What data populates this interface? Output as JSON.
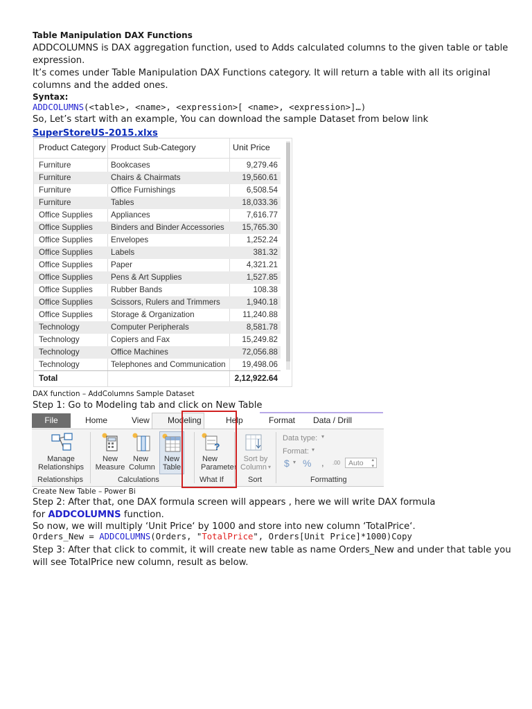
{
  "heading": "Table Manipulation DAX Functions",
  "intro_1": "ADDCOLUMNS is DAX aggregation function, used to Adds calculated columns to the given table or table",
  "intro_2": "expression.",
  "intro_3": "It’s comes under Table Manipulation DAX Functions category. It will return a table with all its original",
  "intro_4": "columns and the added ones.",
  "syntax_label": "Syntax:",
  "syntax_func": "ADDCOLUMNS",
  "syntax_rest": "(<table>, <name>, <expression>[ <name>, <expression>]…)",
  "example_line": "So, Let’s start with an example, You can download the sample Dataset from below link",
  "dataset_link": "SuperStoreUS-2015.xlxs",
  "table": {
    "headers": [
      "Product Category",
      "Product Sub-Category",
      "Unit Price"
    ],
    "rows": [
      [
        "Furniture",
        "Bookcases",
        "9,279.46"
      ],
      [
        "Furniture",
        "Chairs & Chairmats",
        "19,560.61"
      ],
      [
        "Furniture",
        "Office Furnishings",
        "6,508.54"
      ],
      [
        "Furniture",
        "Tables",
        "18,033.36"
      ],
      [
        "Office Supplies",
        "Appliances",
        "7,616.77"
      ],
      [
        "Office Supplies",
        "Binders and Binder Accessories",
        "15,765.30"
      ],
      [
        "Office Supplies",
        "Envelopes",
        "1,252.24"
      ],
      [
        "Office Supplies",
        "Labels",
        "381.32"
      ],
      [
        "Office Supplies",
        "Paper",
        "4,321.21"
      ],
      [
        "Office Supplies",
        "Pens & Art Supplies",
        "1,527.85"
      ],
      [
        "Office Supplies",
        "Rubber Bands",
        "108.38"
      ],
      [
        "Office Supplies",
        "Scissors, Rulers and Trimmers",
        "1,940.18"
      ],
      [
        "Office Supplies",
        "Storage & Organization",
        "11,240.88"
      ],
      [
        "Technology",
        "Computer Peripherals",
        "8,581.78"
      ],
      [
        "Technology",
        "Copiers and Fax",
        "15,249.82"
      ],
      [
        "Technology",
        "Office Machines",
        "72,056.88"
      ],
      [
        "Technology",
        "Telephones and Communication",
        "19,498.06"
      ]
    ],
    "total_label": "Total",
    "total_value": "2,12,922.64"
  },
  "caption_1": "DAX function – AddColumns Sample Dataset",
  "step1": "Step 1: Go to Modeling tab and click on New Table",
  "ribbon": {
    "tabs": {
      "file": "File",
      "home": "Home",
      "view": "View",
      "modeling": "Modeling",
      "help": "Help",
      "format": "Format",
      "data_drill": "Data / Drill"
    },
    "manage_1": "Manage",
    "manage_2": "Relationships",
    "new_measure_1": "New",
    "new_measure_2": "Measure",
    "new_column_1": "New",
    "new_column_2": "Column",
    "new_table_1": "New",
    "new_table_2": "Table",
    "new_param_1": "New",
    "new_param_2": "Parameter",
    "sort_1": "Sort by",
    "sort_2": "Column",
    "data_type": "Data type:",
    "format": "Format:",
    "auto": "Auto",
    "groups": {
      "relationships": "Relationships",
      "calculations": "Calculations",
      "what_if": "What If",
      "sort": "Sort",
      "formatting": "Formatting"
    },
    "colors": {
      "highlight": "#d02020",
      "file_tab": "#6d6d6d"
    }
  },
  "caption_2": "Create New Table – Power Bi",
  "step2_1": "Step 2:  After that, one DAX formula screen will appears , here we will write DAX formula",
  "step2_2a": "for ",
  "step2_2b": "ADDCOLUMNS",
  "step2_2c": " function.",
  "step2_3": "So now, we will multiply ‘Unit Price‘ by 1000 and store into new column ‘TotalPrice‘.",
  "code": {
    "p1": "Orders_New = ",
    "func": "ADDCOLUMNS",
    "p2": "(Orders, \"",
    "str": "TotalPrice",
    "p3": "\", Orders[Unit Price]*1000)Copy"
  },
  "step3_1": "Step 3: After that click to commit, it will create new table as name Orders_New and under that table you",
  "step3_2": "will see TotalPrice new column, result as below."
}
